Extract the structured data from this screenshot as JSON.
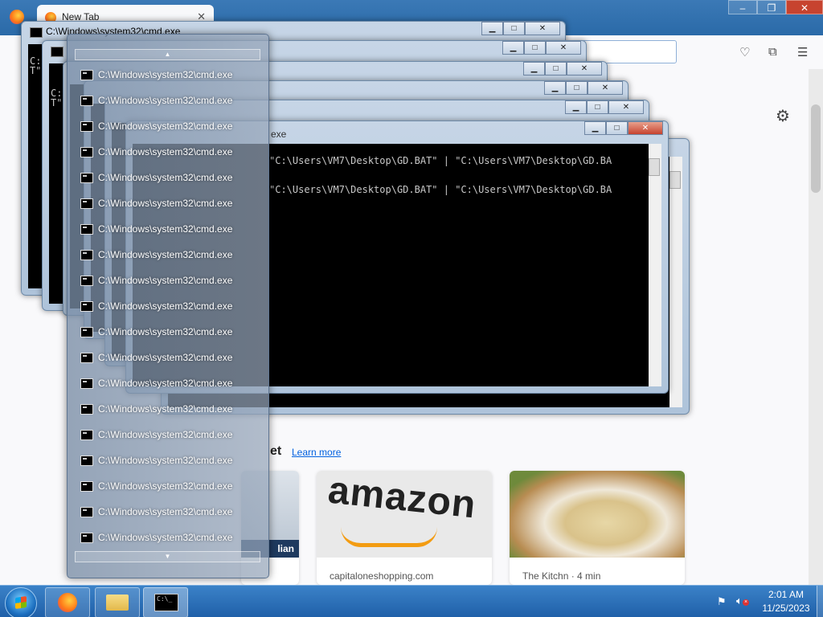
{
  "browser": {
    "tab_title": "New Tab",
    "tab_close": "✕",
    "window_controls": {
      "minimize": "–",
      "maximize": "❐",
      "close": "✕"
    },
    "stories": {
      "heading": "et",
      "learn_more": "Learn more",
      "cards": [
        {
          "source": "capitaloneshopping.com",
          "image_text": "amazon"
        },
        {
          "source": "The Kitchn · 4 min"
        }
      ],
      "left_card_text": "lian"
    }
  },
  "cmd_windows": {
    "title": "C:\\Windows\\system32\\cmd.exe",
    "front_title_fragment": "exe",
    "console_lines": [
      "\"C:\\Users\\VM7\\Desktop\\GD.BAT\" | \"C:\\Users\\VM7\\Desktop\\GD.BA",
      "\"C:\\Users\\VM7\\Desktop\\GD.BAT\" | \"C:\\Users\\VM7\\Desktop\\GD.BA"
    ],
    "back_console_text": [
      "C:",
      "T\"",
      "C:",
      "T\""
    ],
    "buttons": {
      "minimize": "▁",
      "maximize": "□",
      "close": "✕"
    }
  },
  "jumplist": {
    "scroll_up": "▲",
    "scroll_down": "▼",
    "items": [
      "C:\\Windows\\system32\\cmd.exe",
      "C:\\Windows\\system32\\cmd.exe",
      "C:\\Windows\\system32\\cmd.exe",
      "C:\\Windows\\system32\\cmd.exe",
      "C:\\Windows\\system32\\cmd.exe",
      "C:\\Windows\\system32\\cmd.exe",
      "C:\\Windows\\system32\\cmd.exe",
      "C:\\Windows\\system32\\cmd.exe",
      "C:\\Windows\\system32\\cmd.exe",
      "C:\\Windows\\system32\\cmd.exe",
      "C:\\Windows\\system32\\cmd.exe",
      "C:\\Windows\\system32\\cmd.exe",
      "C:\\Windows\\system32\\cmd.exe",
      "C:\\Windows\\system32\\cmd.exe",
      "C:\\Windows\\system32\\cmd.exe",
      "C:\\Windows\\system32\\cmd.exe",
      "C:\\Windows\\system32\\cmd.exe",
      "C:\\Windows\\system32\\cmd.exe",
      "C:\\Windows\\system32\\cmd.exe"
    ]
  },
  "taskbar": {
    "pinned": [
      {
        "name": "firefox-taskbar-button",
        "icon": "firefox-icon"
      },
      {
        "name": "explorer-taskbar-button",
        "icon": "folder-icon"
      },
      {
        "name": "cmd-taskbar-button",
        "icon": "cmd-icon",
        "active": true
      }
    ],
    "clock": {
      "time": "2:01 AM",
      "date": "11/25/2023"
    },
    "tray_icons": [
      "action-center-flag-icon",
      "muted-speaker-icon"
    ]
  }
}
